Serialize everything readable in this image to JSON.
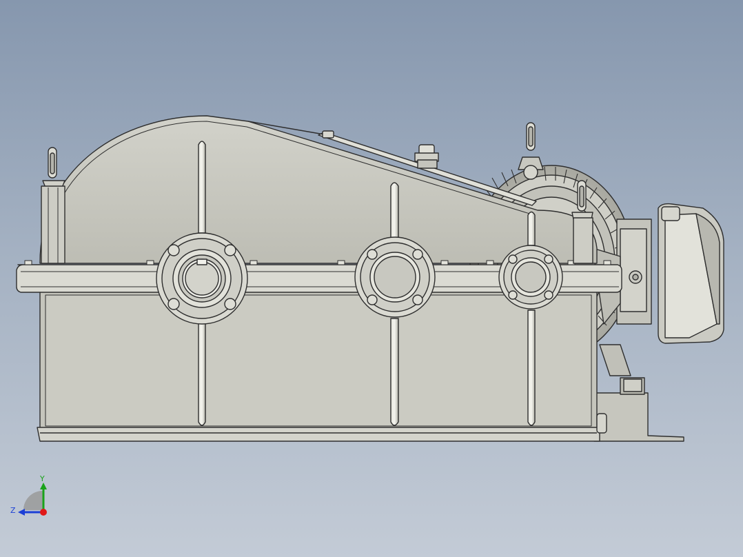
{
  "viewport": {
    "background_top": "#8697ae",
    "background_bottom": "#c3cbd6"
  },
  "model": {
    "name": "gear-reducer-with-motor",
    "body_color": "#c8c8bf",
    "edge_color": "#2e2e2e"
  },
  "triad": {
    "y_label": "Y",
    "z_label": "Z",
    "y_color": "#1aa31a",
    "z_color": "#1b3fd6",
    "x_color": "#e01818"
  }
}
